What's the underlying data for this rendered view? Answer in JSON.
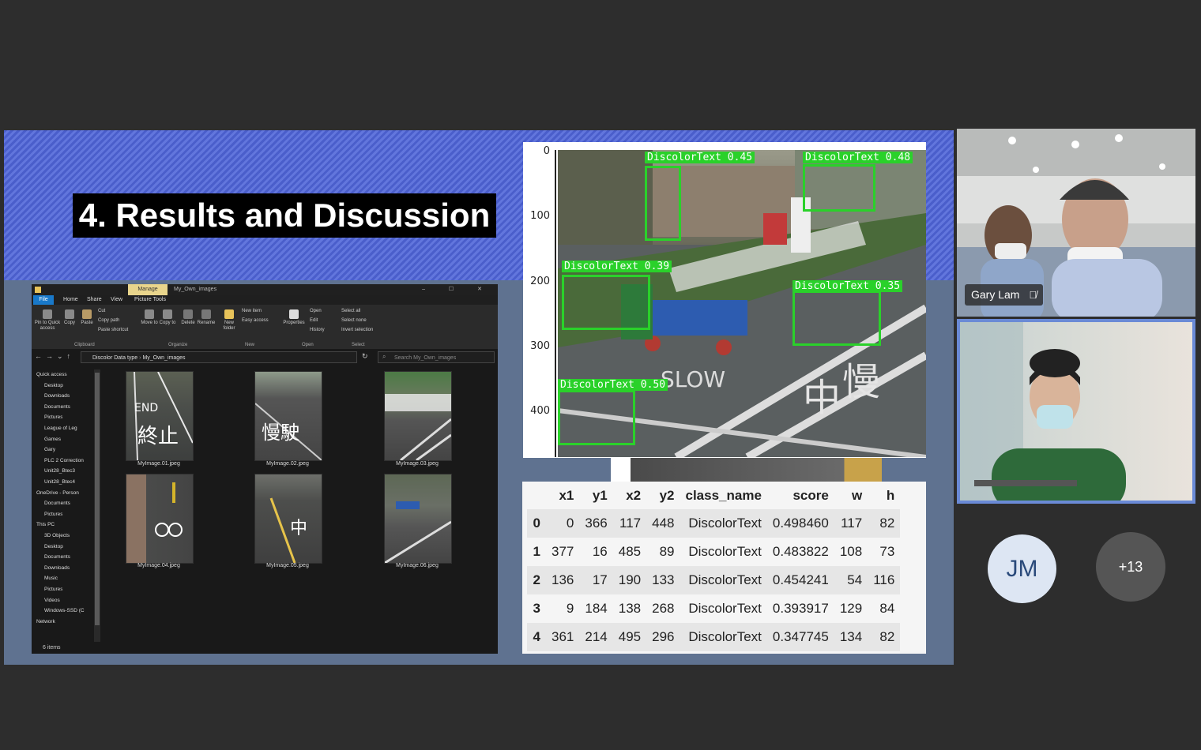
{
  "slide": {
    "title": "4. Results and Discussion"
  },
  "explorer": {
    "ribbon_context_tab": "Manage",
    "window_title": "My_Own_images",
    "window_buttons": "–  ☐  ✕",
    "tabs": [
      "File",
      "Home",
      "Share",
      "View",
      "Picture Tools"
    ],
    "ribbon": {
      "pin_to_quick_access": "Pin to Quick access",
      "copy": "Copy",
      "paste": "Paste",
      "cut": "Cut",
      "copy_path": "Copy path",
      "paste_shortcut": "Paste shortcut",
      "move_to": "Move to",
      "copy_to": "Copy to",
      "delete": "Delete",
      "rename": "Rename",
      "new_folder": "New folder",
      "new_item": "New item",
      "easy_access": "Easy access",
      "properties": "Properties",
      "open": "Open",
      "edit": "Edit",
      "history": "History",
      "select_all": "Select all",
      "select_none": "Select none",
      "invert_selection": "Invert selection",
      "groups": [
        "Clipboard",
        "Organize",
        "New",
        "Open",
        "Select"
      ]
    },
    "breadcrumb": [
      "Discolor Data type",
      "My_Own_images"
    ],
    "search_placeholder": "Search My_Own_images",
    "nav_items": [
      "Quick access",
      "Desktop",
      "Downloads",
      "Documents",
      "Pictures",
      "League of Leg",
      "Games",
      "Gary",
      "PLC 2 Correction",
      "Unit28_Btec3",
      "Unit28_Btec4",
      "OneDrive - Person",
      "Documents",
      "Pictures",
      "This PC",
      "3D Objects",
      "Desktop",
      "Documents",
      "Downloads",
      "Music",
      "Pictures",
      "Videos",
      "Windows-SSD (C",
      "Network"
    ],
    "files": [
      "MyImage.01.jpeg",
      "MyImage.02.jpeg",
      "MyImage.03.jpeg",
      "MyImage.04.jpeg",
      "MyImage.05.jpeg",
      "MyImage.06.jpeg"
    ],
    "status": "6 items"
  },
  "plot": {
    "y_ticks": [
      "0",
      "100",
      "200",
      "300",
      "400"
    ],
    "detections": [
      {
        "label": "DiscolorText 0.45"
      },
      {
        "label": "DiscolorText 0.48"
      },
      {
        "label": "DiscolorText 0.39"
      },
      {
        "label": "DiscolorText 0.35"
      },
      {
        "label": "DiscolorText 0.50"
      }
    ]
  },
  "table": {
    "columns": [
      "",
      "x1",
      "y1",
      "x2",
      "y2",
      "class_name",
      "score",
      "w",
      "h"
    ],
    "rows": [
      [
        "0",
        "0",
        "366",
        "117",
        "448",
        "DiscolorText",
        "0.498460",
        "117",
        "82"
      ],
      [
        "1",
        "377",
        "16",
        "485",
        "89",
        "DiscolorText",
        "0.483822",
        "108",
        "73"
      ],
      [
        "2",
        "136",
        "17",
        "190",
        "133",
        "DiscolorText",
        "0.454241",
        "54",
        "116"
      ],
      [
        "3",
        "9",
        "184",
        "138",
        "268",
        "DiscolorText",
        "0.393917",
        "129",
        "84"
      ],
      [
        "4",
        "361",
        "214",
        "495",
        "296",
        "DiscolorText",
        "0.347745",
        "134",
        "82"
      ]
    ]
  },
  "participants": {
    "video1_name": "Gary Lam",
    "avatar_initials": "JM",
    "more_count": "+13"
  }
}
